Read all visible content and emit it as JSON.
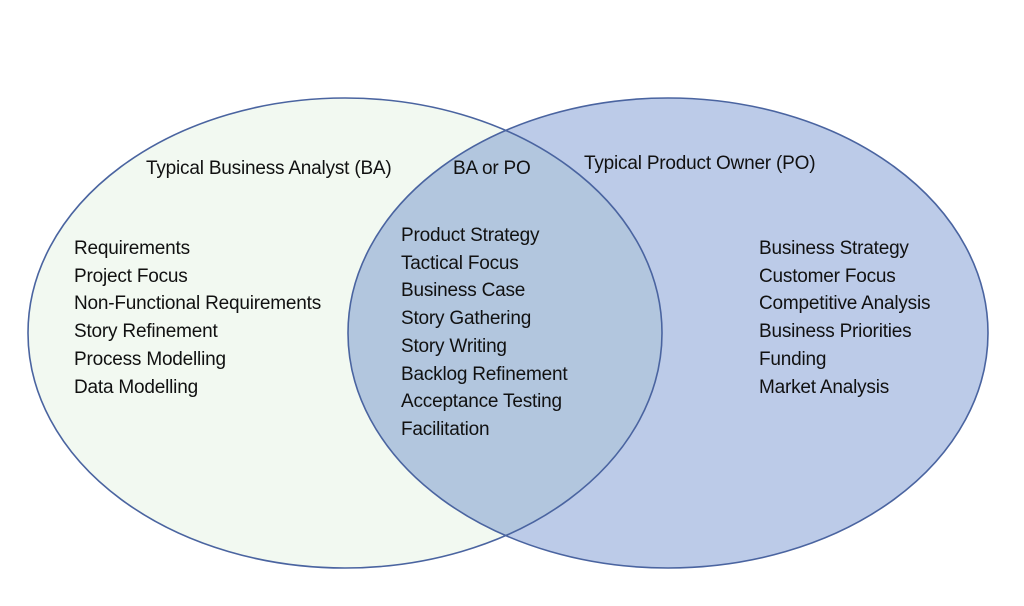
{
  "diagram": {
    "type": "venn",
    "colors": {
      "ba_fill": "#f2f9f1",
      "po_fill": "#bccbe8",
      "overlap_fill": "#b2c6de",
      "stroke": "#4a64a0",
      "text": "#111111"
    },
    "sets": [
      {
        "id": "ba",
        "title": "Typical Business Analyst (BA)",
        "items": [
          "Requirements",
          "Project Focus",
          "Non-Functional Requirements",
          "Story Refinement",
          "Process Modelling",
          "Data Modelling"
        ]
      },
      {
        "id": "overlap",
        "title": "BA or PO",
        "items": [
          "Product Strategy",
          "Tactical Focus",
          "Business Case",
          "Story Gathering",
          "Story Writing",
          "Backlog Refinement",
          "Acceptance Testing",
          "Facilitation"
        ]
      },
      {
        "id": "po",
        "title": "Typical Product Owner (PO)",
        "items": [
          "Business Strategy",
          "Customer Focus",
          "Competitive Analysis",
          "Business Priorities",
          "Funding",
          "Market Analysis"
        ]
      }
    ]
  }
}
